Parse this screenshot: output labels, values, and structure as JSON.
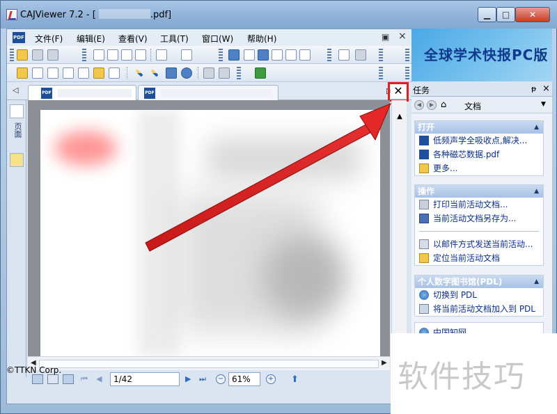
{
  "window": {
    "title": "CAJViewer 7.2 - [",
    "title_suffix": ".pdf]",
    "min_label": "▁",
    "max_label": "□",
    "close_label": "✕"
  },
  "menu": {
    "items": [
      "文件(F)",
      "编辑(E)",
      "查看(V)",
      "工具(T)",
      "窗口(W)",
      "帮助(H)"
    ],
    "restore_label": "▣",
    "close_label": "×"
  },
  "tabs": {
    "arrow_label": "◁",
    "right_label": "▷",
    "close_label": "✕"
  },
  "sidebar": {
    "page_label": "页面"
  },
  "pdf_label": "PDF",
  "status": {
    "page_value": "1/42",
    "zoom_value": "61%",
    "zoom_minus": "−",
    "zoom_plus": "+",
    "copyright": "©TTKN Corp."
  },
  "banner": {
    "text": "全球学术快报PC版"
  },
  "task_panel": {
    "title": "任务",
    "pin_label": "ᵽ",
    "close_label": "×",
    "nav_label": "文档",
    "sections": [
      {
        "title": "打开",
        "items": [
          {
            "label": "低频声学全吸收点,解决...",
            "icon": "pdf-icon"
          },
          {
            "label": "各种磁芯数据.pdf",
            "icon": "pdf-icon"
          },
          {
            "label": "更多...",
            "icon": "folder-icon"
          }
        ]
      },
      {
        "title": "操作",
        "items": [
          {
            "label": "打印当前活动文档...",
            "icon": "print-icon"
          },
          {
            "label": "当前活动文档另存为...",
            "icon": "save-icon"
          },
          {
            "label": "以邮件方式发送当前活动...",
            "icon": "mail-icon"
          },
          {
            "label": "定位当前活动文档",
            "icon": "folder-icon"
          }
        ]
      },
      {
        "title": "个人数字图书馆(PDL)",
        "items": [
          {
            "label": "切换到 PDL",
            "icon": "globe-icon"
          },
          {
            "label": "将当前活动文档加入到 PDL",
            "icon": "add-icon"
          }
        ]
      },
      {
        "title": "",
        "items": [
          {
            "label": "中国知网",
            "icon": "globe-icon"
          }
        ]
      }
    ]
  },
  "watermark": {
    "text": "软件技巧"
  },
  "colors": {
    "highlight": "#e02020",
    "arrow": "#d42020",
    "link": "#0b2f8c",
    "banner_text": "#0f3a8c"
  }
}
